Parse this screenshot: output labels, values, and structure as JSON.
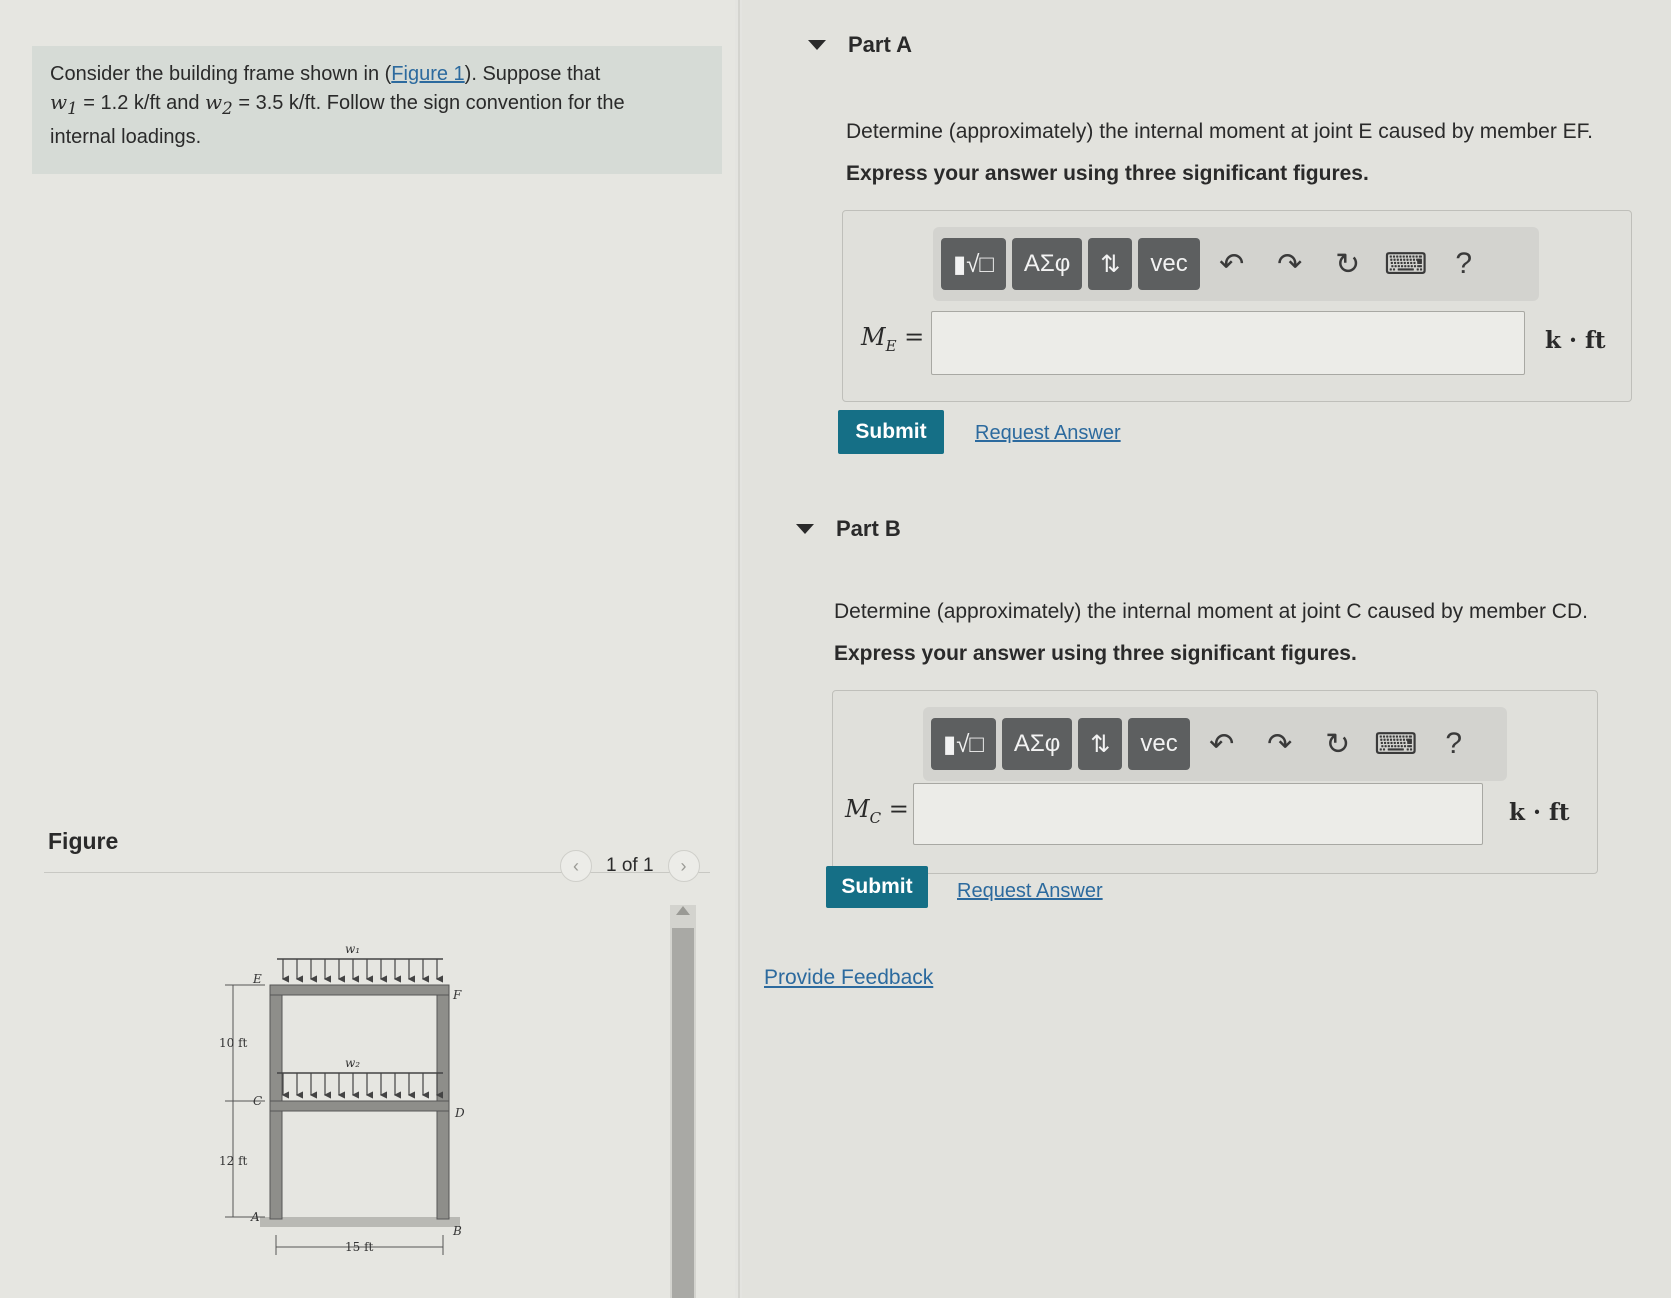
{
  "problem": {
    "line1_prefix": "Consider the building frame shown in (",
    "figure_link": "Figure 1",
    "line1_suffix": "). Suppose that",
    "w1_sym": "w",
    "w1_sub": "1",
    "w1_value": " = 1.2 k/ft",
    "and_text": " and ",
    "w2_sym": "w",
    "w2_sub": "2",
    "w2_value": " = 3.5 k/ft",
    "line2_suffix": ". Follow the sign convention for the",
    "line3": "internal loadings."
  },
  "figure": {
    "title": "Figure",
    "pager_text": "1 of 1",
    "labels": {
      "w1": "w₁",
      "w2": "w₂",
      "E": "E",
      "F": "F",
      "C": "C",
      "D": "D",
      "A": "A",
      "B": "B",
      "dim_10": "10 ft",
      "dim_12": "12 ft",
      "dim_15": "15 ft"
    }
  },
  "parts": [
    {
      "header": "Part A",
      "question": "Determine (approximately) the internal moment at joint E caused by member EF.",
      "instruction": "Express your answer using three significant figures.",
      "var_symbol": "M",
      "var_sub": "E",
      "equals": " =",
      "input_value": "",
      "unit": "k · ft",
      "submit": "Submit",
      "request": "Request Answer"
    },
    {
      "header": "Part B",
      "question": "Determine (approximately) the internal moment at joint C caused by member CD.",
      "instruction": "Express your answer using three significant figures.",
      "var_symbol": "M",
      "var_sub": "C",
      "equals": " =",
      "input_value": "",
      "unit": "k · ft",
      "submit": "Submit",
      "request": "Request Answer"
    }
  ],
  "toolbar": {
    "templates": "▮√□",
    "greek": "ΑΣφ",
    "arrows": "⇅",
    "vec": "vec",
    "undo": "↶",
    "redo": "↷",
    "reset": "↻",
    "keyboard": "⌨",
    "help": "?"
  },
  "feedback": "Provide Feedback",
  "colors": {
    "submit": "#156f86",
    "link": "#2c6a9e",
    "toolbar_button": "#5d5f60"
  }
}
